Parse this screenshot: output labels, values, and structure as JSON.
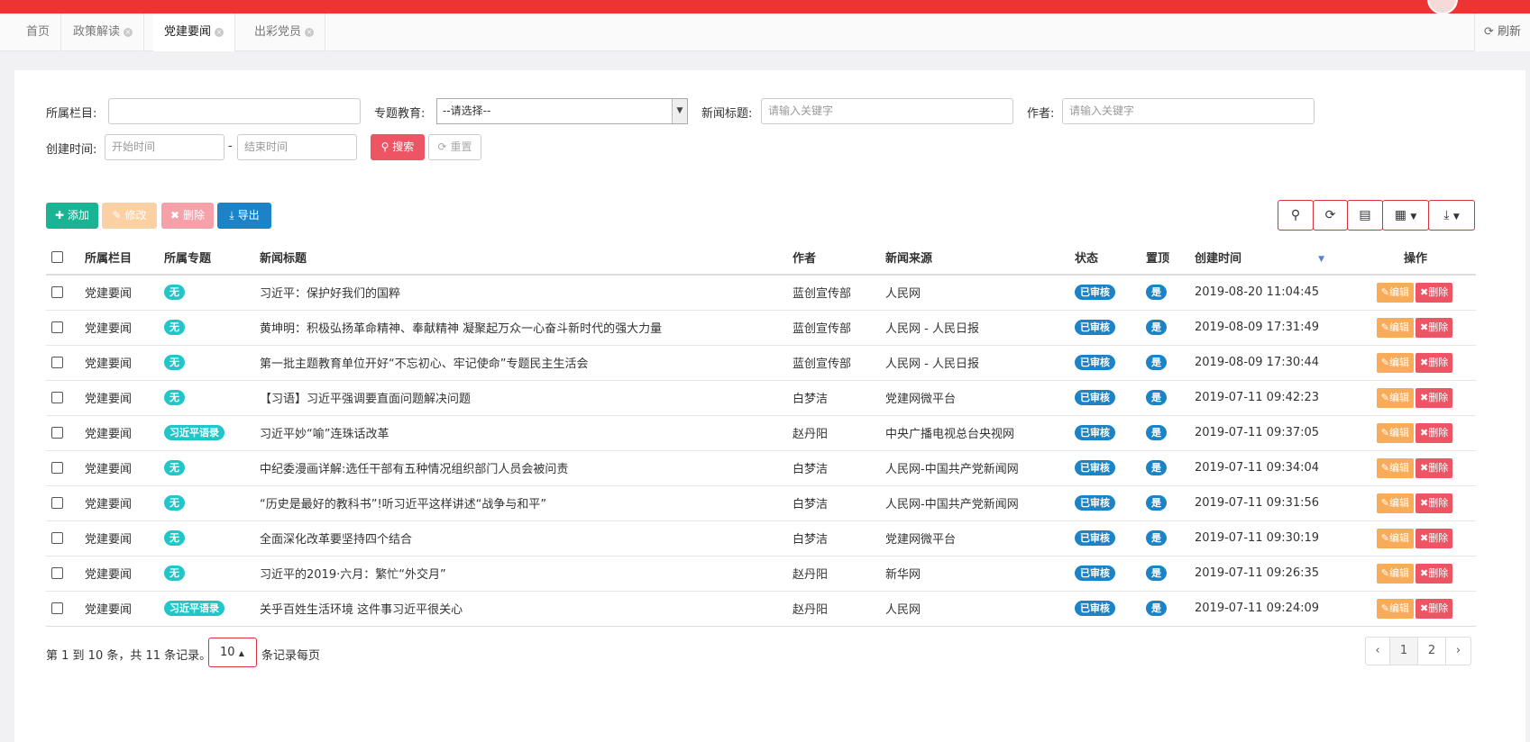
{
  "tabs": [
    {
      "label": "首页",
      "closable": false,
      "active": false
    },
    {
      "label": "政策解读",
      "closable": true,
      "active": false
    },
    {
      "label": "党建要闻",
      "closable": true,
      "active": true
    },
    {
      "label": "出彩党员",
      "closable": true,
      "active": false
    }
  ],
  "tab_close_glyph": "×",
  "refresh_label": "刷新",
  "filters": {
    "column_label": "所属栏目:",
    "column_value": "",
    "topic_label": "专题教育:",
    "topic_value": "--请选择--",
    "news_title_label": "新闻标题:",
    "news_title_placeholder": "请输入关键字",
    "author_label": "作者:",
    "author_placeholder": "请输入关键字",
    "created_label": "创建时间:",
    "start_placeholder": "开始时间",
    "range_sep": "-",
    "end_placeholder": "结束时间",
    "search_label": "搜索",
    "reset_label": "重置"
  },
  "actions": {
    "add_label": "添加",
    "edit_label": "修改",
    "delete_label": "删除",
    "export_label": "导出"
  },
  "toolbar_icons": [
    "search-icon",
    "refresh-icon",
    "columns-icon",
    "grid-icon",
    "download-icon"
  ],
  "table": {
    "headers": [
      "所属栏目",
      "所属专题",
      "新闻标题",
      "作者",
      "新闻来源",
      "状态",
      "置顶",
      "创建时间",
      "操作"
    ],
    "edit_label": "编辑",
    "delete_label": "删除",
    "rows": [
      {
        "column": "党建要闻",
        "topic": "无",
        "title": "习近平：保护好我们的国粹",
        "author": "蓝创宣传部",
        "source": "人民网",
        "status": "已审核",
        "top": "是",
        "created": "2019-08-20 11:04:45"
      },
      {
        "column": "党建要闻",
        "topic": "无",
        "title": "黄坤明：积极弘扬革命精神、奉献精神 凝聚起万众一心奋斗新时代的强大力量",
        "author": "蓝创宣传部",
        "source": "人民网 - 人民日报",
        "status": "已审核",
        "top": "是",
        "created": "2019-08-09 17:31:49"
      },
      {
        "column": "党建要闻",
        "topic": "无",
        "title": "第一批主题教育单位开好“不忘初心、牢记使命”专题民主生活会",
        "author": "蓝创宣传部",
        "source": "人民网 - 人民日报",
        "status": "已审核",
        "top": "是",
        "created": "2019-08-09 17:30:44"
      },
      {
        "column": "党建要闻",
        "topic": "无",
        "title": "【习语】习近平强调要直面问题解决问题",
        "author": "白梦洁",
        "source": "党建网微平台",
        "status": "已审核",
        "top": "是",
        "created": "2019-07-11 09:42:23"
      },
      {
        "column": "党建要闻",
        "topic": "习近平语录",
        "title": "习近平妙“喻”连珠话改革",
        "author": "赵丹阳",
        "source": "中央广播电视总台央视网",
        "status": "已审核",
        "top": "是",
        "created": "2019-07-11 09:37:05"
      },
      {
        "column": "党建要闻",
        "topic": "无",
        "title": "中纪委漫画详解:选任干部有五种情况组织部门人员会被问责",
        "author": "白梦洁",
        "source": "人民网-中国共产党新闻网",
        "status": "已审核",
        "top": "是",
        "created": "2019-07-11 09:34:04"
      },
      {
        "column": "党建要闻",
        "topic": "无",
        "title": "“历史是最好的教科书”!听习近平这样讲述“战争与和平”",
        "author": "白梦洁",
        "source": "人民网-中国共产党新闻网",
        "status": "已审核",
        "top": "是",
        "created": "2019-07-11 09:31:56"
      },
      {
        "column": "党建要闻",
        "topic": "无",
        "title": "全面深化改革要坚持四个结合",
        "author": "白梦洁",
        "source": "党建网微平台",
        "status": "已审核",
        "top": "是",
        "created": "2019-07-11 09:30:19"
      },
      {
        "column": "党建要闻",
        "topic": "无",
        "title": "习近平的2019·六月：繁忙“外交月”",
        "author": "赵丹阳",
        "source": "新华网",
        "status": "已审核",
        "top": "是",
        "created": "2019-07-11 09:26:35"
      },
      {
        "column": "党建要闻",
        "topic": "习近平语录",
        "title": "关乎百姓生活环境 这件事习近平很关心",
        "author": "赵丹阳",
        "source": "人民网",
        "status": "已审核",
        "top": "是",
        "created": "2019-07-11 09:24:09"
      }
    ]
  },
  "pagination": {
    "summary": "第 1 到 10 条，共 11 条记录。",
    "page_size": "10",
    "per_page_suffix": "条记录每页",
    "prev": "‹",
    "next": "›",
    "pages": [
      "1",
      "2"
    ],
    "current": "1"
  },
  "colors": {
    "brand_red": "#ee3333",
    "primary_green": "#1ab394",
    "info_blue": "#1c84c6",
    "warning_orange": "#f8ac59",
    "danger_red": "#ed5565",
    "teal": "#23c6c8"
  }
}
